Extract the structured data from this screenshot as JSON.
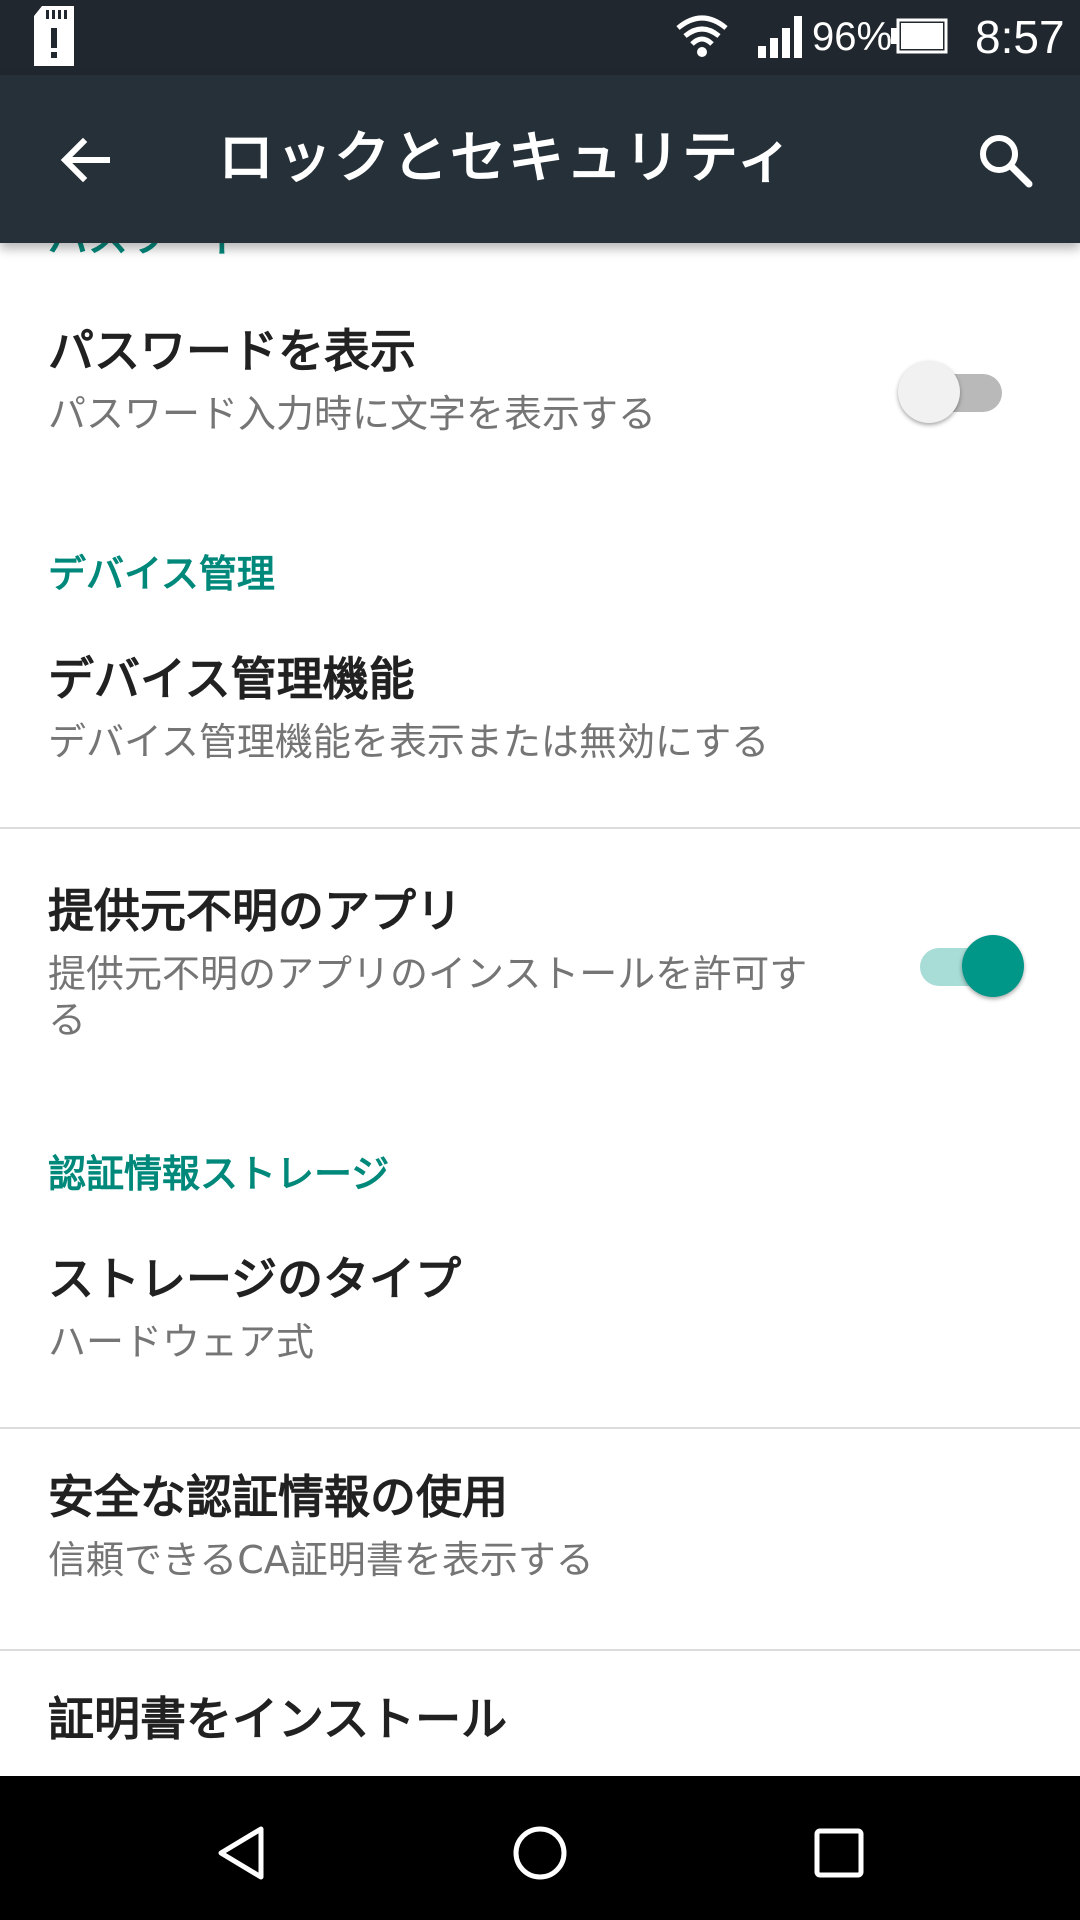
{
  "status_bar": {
    "battery": "96%",
    "time": "8:57",
    "icons": [
      "sd-card-alert-icon",
      "wifi-icon",
      "signal-icon",
      "battery-icon"
    ]
  },
  "app_bar": {
    "title": "ロックとセキュリティ",
    "back_icon": "arrow-back-icon",
    "search_icon": "search-icon"
  },
  "partial_section_header": "パスワード",
  "sections": {
    "show_password": {
      "title": "パスワードを表示",
      "summary": "パスワード入力時に文字を表示する",
      "toggle": "off"
    },
    "device_admin_header": "デバイス管理",
    "device_admin": {
      "title": "デバイス管理機能",
      "summary": "デバイス管理機能を表示または無効にする"
    },
    "unknown_sources": {
      "title": "提供元不明のアプリ",
      "summary": "提供元不明のアプリのインストールを許可する",
      "toggle": "on"
    },
    "credential_header": "認証情報ストレージ",
    "storage_type": {
      "title": "ストレージのタイプ",
      "summary": "ハードウェア式"
    },
    "trusted_credentials": {
      "title": "安全な認証情報の使用",
      "summary": "信頼できるCA証明書を表示する"
    },
    "install_certificates": {
      "title": "証明書をインストール"
    }
  },
  "nav_bar": {
    "back": "nav-back-icon",
    "home": "nav-home-icon",
    "recents": "nav-recents-icon"
  },
  "colors": {
    "accent": "#009688",
    "section_header": "#00897b",
    "app_bar": "#263038",
    "status_bar": "#21272e"
  }
}
